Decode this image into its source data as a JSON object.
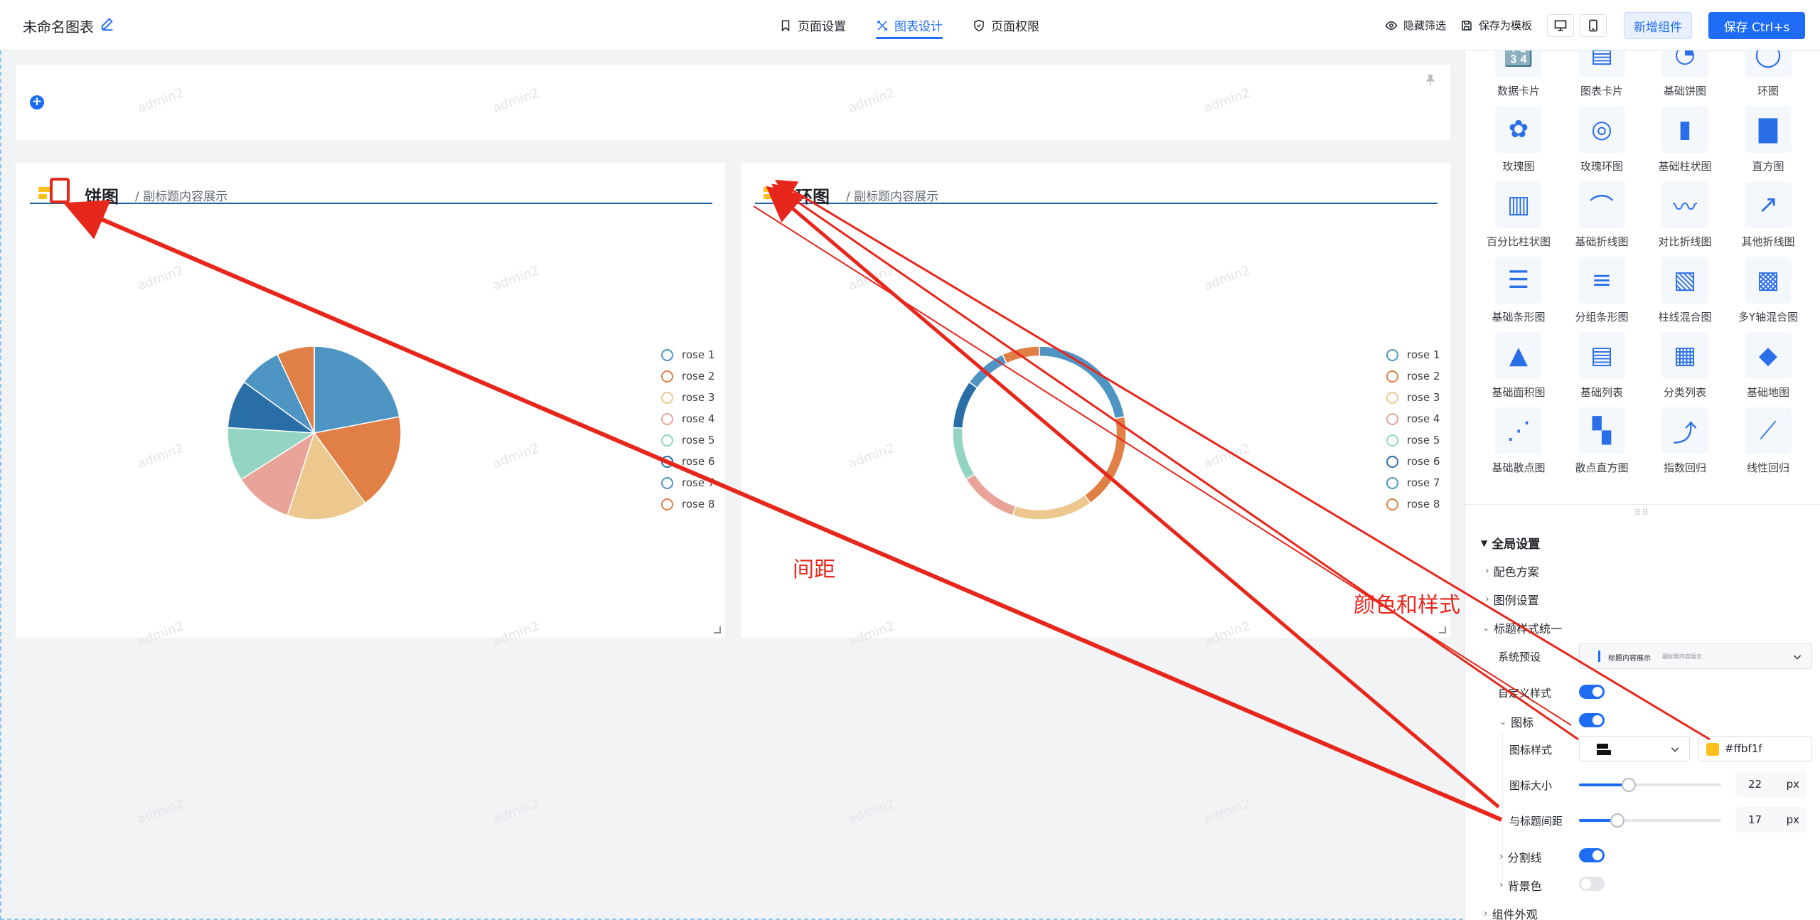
{
  "topbar": {
    "title": "未命名图表",
    "tabs": [
      {
        "label": "页面设置",
        "icon": "bookmark-icon"
      },
      {
        "label": "图表设计",
        "icon": "design-icon"
      },
      {
        "label": "页面权限",
        "icon": "shield-icon"
      }
    ],
    "hide_filter": "隐藏筛选",
    "save_template": "保存为模板",
    "add_component": "新增组件",
    "save": "保存 Ctrl+s"
  },
  "watermark": "admin2",
  "cards": [
    {
      "title": "饼图",
      "subtitle": "/ 副标题内容展示",
      "chart": "pie"
    },
    {
      "title": "环图",
      "subtitle": "/ 副标题内容展示",
      "chart": "donut"
    }
  ],
  "chart_data": [
    {
      "type": "pie",
      "series": [
        {
          "name": "rose 1",
          "value": 22
        },
        {
          "name": "rose 2",
          "value": 18
        },
        {
          "name": "rose 3",
          "value": 15
        },
        {
          "name": "rose 4",
          "value": 11
        },
        {
          "name": "rose 5",
          "value": 10
        },
        {
          "name": "rose 6",
          "value": 9
        },
        {
          "name": "rose 7",
          "value": 8
        },
        {
          "name": "rose 8",
          "value": 7
        }
      ],
      "colors": [
        "#4e95c4",
        "#e07f46",
        "#ecc88f",
        "#e9a49a",
        "#93d5c2",
        "#2a6ea8",
        "#4e95c4",
        "#e07f46"
      ]
    },
    {
      "type": "donut",
      "series": [
        {
          "name": "rose 1",
          "value": 22
        },
        {
          "name": "rose 2",
          "value": 18
        },
        {
          "name": "rose 3",
          "value": 15
        },
        {
          "name": "rose 4",
          "value": 11
        },
        {
          "name": "rose 5",
          "value": 10
        },
        {
          "name": "rose 6",
          "value": 9
        },
        {
          "name": "rose 7",
          "value": 8
        },
        {
          "name": "rose 8",
          "value": 7
        }
      ],
      "colors": [
        "#4e95c4",
        "#e07f46",
        "#ecc88f",
        "#e9a49a",
        "#93d5c2",
        "#2a6ea8",
        "#4e95c4",
        "#e07f46"
      ]
    }
  ],
  "components": [
    "数据卡片",
    "图表卡片",
    "基础饼图",
    "环图",
    "玫瑰图",
    "玫瑰环图",
    "基础柱状图",
    "直方图",
    "百分比柱状图",
    "基础折线图",
    "对比折线图",
    "其他折线图",
    "基础条形图",
    "分组条形图",
    "柱线混合图",
    "多Y轴混合图",
    "基础面积图",
    "基础列表",
    "分类列表",
    "基础地图",
    "基础散点图",
    "散点直方图",
    "指数回归",
    "线性回归"
  ],
  "settings": {
    "global": "全局设置",
    "color_scheme": "配色方案",
    "legend": "图例设置",
    "title_style": "标题样式统一",
    "preset_label": "系统预设",
    "preset_value_main": "标题内容展示",
    "preset_value_sub": "副标题内容展示",
    "custom_style": "自定义样式",
    "icon": "图标",
    "icon_style": "图标样式",
    "icon_color": "#ffbf1f",
    "icon_size_label": "图标大小",
    "icon_size": "22",
    "icon_gap_label": "与标题间距",
    "icon_gap": "17",
    "unit": "px",
    "divider": "分割线",
    "bg_color": "背景色",
    "appearance": "组件外观"
  },
  "annotations": {
    "spacing": "间距",
    "color_style": "颜色和样式"
  }
}
